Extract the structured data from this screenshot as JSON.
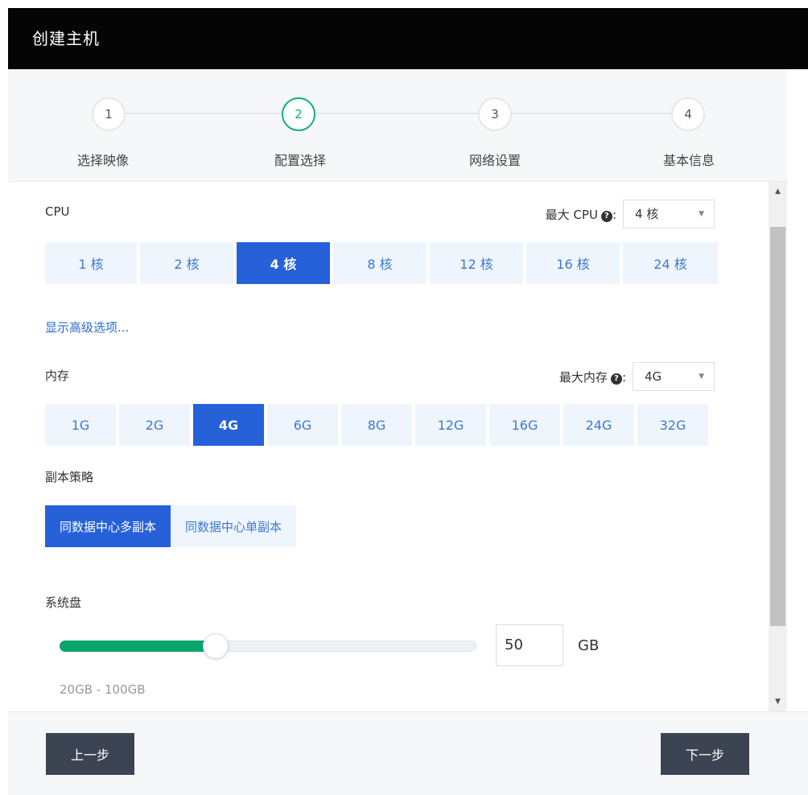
{
  "dialog": {
    "title": "创建主机"
  },
  "steps": [
    {
      "number": "1",
      "label": "选择映像"
    },
    {
      "number": "2",
      "label": "配置选择"
    },
    {
      "number": "3",
      "label": "网络设置"
    },
    {
      "number": "4",
      "label": "基本信息"
    }
  ],
  "active_step": 2,
  "cpu": {
    "label": "CPU",
    "max_label": "最大 CPU",
    "max_value": "4 核",
    "options": [
      "1 核",
      "2 核",
      "4 核",
      "8 核",
      "12 核",
      "16 核",
      "24 核"
    ],
    "selected": "4 核"
  },
  "advanced_link": "显示高级选项...",
  "memory": {
    "label": "内存",
    "max_label": "最大内存",
    "max_value": "4G",
    "options": [
      "1G",
      "2G",
      "4G",
      "6G",
      "8G",
      "12G",
      "16G",
      "24G",
      "32G"
    ],
    "selected": "4G"
  },
  "replica": {
    "label": "副本策略",
    "options": [
      "同数据中心多副本",
      "同数据中心单副本"
    ],
    "selected": "同数据中心多副本"
  },
  "system_disk": {
    "label": "系统盘",
    "value": "50",
    "unit": "GB",
    "min": 20,
    "max": 100,
    "range_text": "20GB - 100GB"
  },
  "footer": {
    "prev_label": "上一步",
    "next_label": "下一步"
  },
  "colors": {
    "primary": "#2661d9",
    "success": "#0cb07b",
    "slider_fill": "#0aa56c",
    "option_bg": "#eef5fd",
    "button_dark": "#3c4352"
  }
}
